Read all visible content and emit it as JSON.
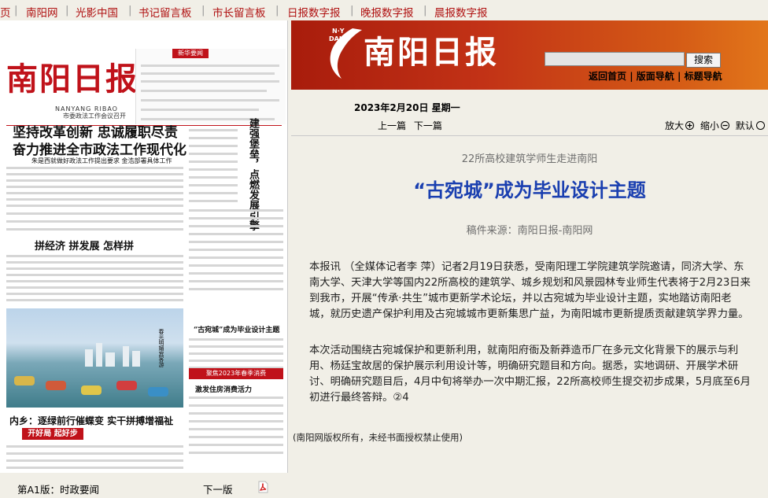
{
  "topnav": {
    "items": [
      "页",
      "南阳网",
      "光影中国",
      "书记留言板",
      "市长留言板",
      "日报数字报",
      "晚报数字报",
      "晨报数字报"
    ]
  },
  "paper": {
    "masthead": "南阳日报",
    "pinyin": "NANYANG   RIBAO",
    "column_tag": "新华要闻",
    "headline_kicker": "市委政法工作会议召开",
    "headline_1": "坚持改革创新 忠诚履职尽责",
    "headline_2": "奋力推进全市政法工作现代化",
    "headline_sub": "朱是西就做好政法工作提出要求 金浩部署具体工作",
    "side_headline": "建强堡垒，点燃发展引擎",
    "section_head": "拼经济 拼发展 怎样拼",
    "box_heading": "“古宛城”成为毕业设计主题",
    "photo_caption": "春光明媚宾客游",
    "lower_headline": "内乡：逐绿前行催蝶变 实干拼搏增福祉",
    "lower_tag": "开好局 起好步",
    "ad_text": "聚焦2023年春季消费",
    "ad_title": "激发住房消费活力"
  },
  "bottombar": {
    "page_label": "第A1版：时政要闻",
    "next_page": "下一版",
    "pdf_icon": "pdf-icon"
  },
  "banner": {
    "logo_small": "N·Y DAILY",
    "logo": "南阳日报",
    "search_placeholder": "",
    "search_button": "搜索",
    "nav_home": "返回首页",
    "nav_layout": "版面导航",
    "nav_title": "标题导航",
    "nav_sep": "|"
  },
  "article": {
    "date": "2023年2月20日 星期一",
    "prev": "上一篇",
    "next": "下一篇",
    "zoom_in": "放大",
    "zoom_out": "缩小",
    "default": "默认",
    "subtitle": "22所高校建筑学师生走进南阳",
    "title": "“古宛城”成为毕业设计主题",
    "source": "稿件来源：南阳日报-南阳网",
    "paragraphs": [
      "本报讯 （全媒体记者李 萍）记者2月19日获悉，受南阳理工学院建筑学院邀请，同济大学、东南大学、天津大学等国内22所高校的建筑学、城乡规划和风景园林专业师生代表将于2月23日来到我市，开展“传承·共生”城市更新学术论坛，并以古宛城为毕业设计主题，实地踏访南阳老城，就历史遗产保护利用及古宛城城市更新集思广益，为南阳城市更新提质贡献建筑学界力量。",
      "本次活动围绕古宛城保护和更新利用，就南阳府衙及新莽造币厂在多元文化背景下的展示与利用、杨廷宝故居的保护展示利用设计等，明确研究题目和方向。据悉，实地调研、开展学术研讨、明确研究题目后，4月中旬将举办一次中期汇报，22所高校师生提交初步成果，5月底至6月初进行最终答辩。②4"
    ],
    "copyright": "(南阳网版权所有，未经书面授权禁止使用)"
  },
  "colors": {
    "accent_red": "#c0121a",
    "title_blue": "#1a3fb0",
    "background": "#f1efe7"
  }
}
